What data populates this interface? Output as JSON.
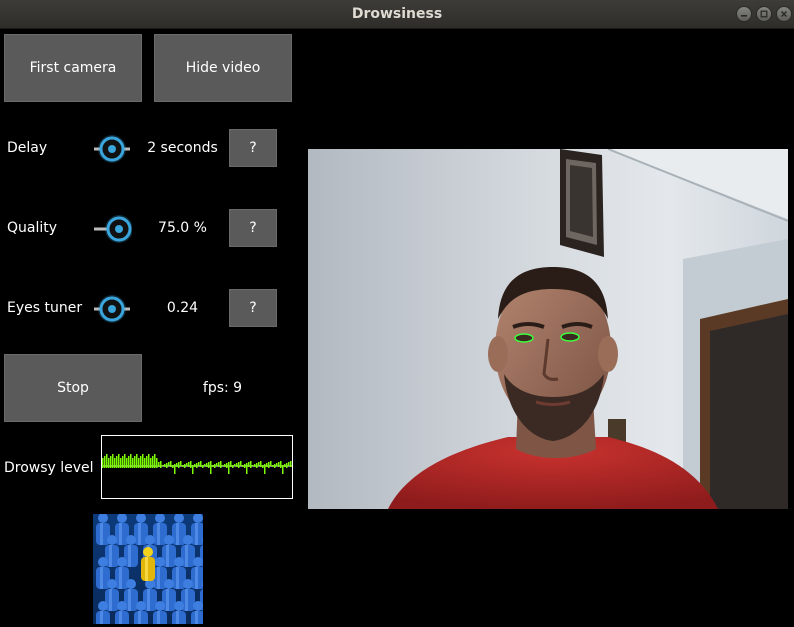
{
  "window": {
    "title": "Drowsiness"
  },
  "buttons": {
    "camera": "First camera",
    "hide_video": "Hide video",
    "stop": "Stop",
    "help": "?"
  },
  "controls": {
    "delay": {
      "label": "Delay",
      "value": "2 seconds",
      "level": 0.5
    },
    "quality": {
      "label": "Quality",
      "value": "75.0 %",
      "level": 0.75
    },
    "eyes_tuner": {
      "label": "Eyes tuner",
      "value": "0.24",
      "level": 0.5
    }
  },
  "status": {
    "fps": "fps: 9"
  },
  "drowsy": {
    "label": "Drowsy level"
  },
  "colors": {
    "accent": "#3aa6dd",
    "graph_line": "#7cfc00",
    "button_bg": "#5a5a5a"
  }
}
